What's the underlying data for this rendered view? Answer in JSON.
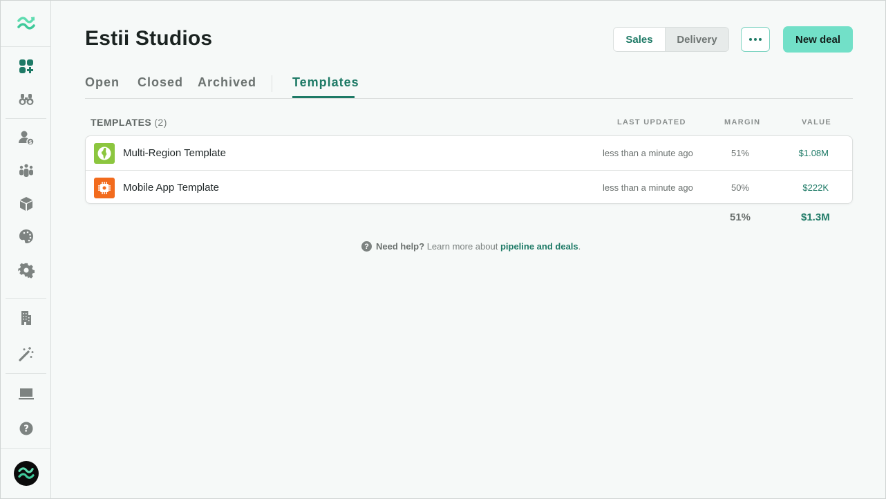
{
  "sidebar": {
    "logo": "wave-logo-icon",
    "items": [
      {
        "name": "dashboard",
        "icon": "apps-plus-icon",
        "active": true
      },
      {
        "name": "discover",
        "icon": "binoculars-icon"
      },
      {
        "name": "clients",
        "icon": "user-dollar-icon"
      },
      {
        "name": "team",
        "icon": "people-group-icon"
      },
      {
        "name": "products",
        "icon": "cube-icon"
      },
      {
        "name": "branding",
        "icon": "palette-icon"
      },
      {
        "name": "settings",
        "icon": "gear-icon"
      },
      {
        "name": "company",
        "icon": "building-icon"
      },
      {
        "name": "magic",
        "icon": "magic-wand-icon"
      },
      {
        "name": "display",
        "icon": "laptop-icon"
      },
      {
        "name": "help",
        "icon": "question-icon"
      }
    ]
  },
  "header": {
    "title": "Estii Studios",
    "segment": {
      "options": [
        "Sales",
        "Delivery"
      ],
      "selected": "Sales"
    },
    "more_label": "More options",
    "new_deal_label": "New deal"
  },
  "tabs": {
    "items": [
      "Open",
      "Closed",
      "Archived",
      "Templates"
    ],
    "active": "Templates"
  },
  "table": {
    "title": "TEMPLATES",
    "count": "(2)",
    "columns": {
      "last_updated": "LAST UPDATED",
      "margin": "MARGIN",
      "value": "VALUE"
    },
    "rows": [
      {
        "name": "Multi-Region Template",
        "icon": "globe-icon",
        "icon_color": "#8cc63f",
        "last_updated": "less than a minute ago",
        "margin": "51%",
        "value": "$1.08M"
      },
      {
        "name": "Mobile App Template",
        "icon": "chip-icon",
        "icon_color": "#f26b1d",
        "last_updated": "less than a minute ago",
        "margin": "50%",
        "value": "$222K"
      }
    ],
    "totals": {
      "margin": "51%",
      "value": "$1.3M"
    }
  },
  "help": {
    "lead": "Need help?",
    "text": "Learn more about",
    "link": "pipeline and deals",
    "suffix": "."
  },
  "colors": {
    "accent": "#1e7a66",
    "accent_light": "#72e0c8",
    "background": "#f6f9f8"
  }
}
